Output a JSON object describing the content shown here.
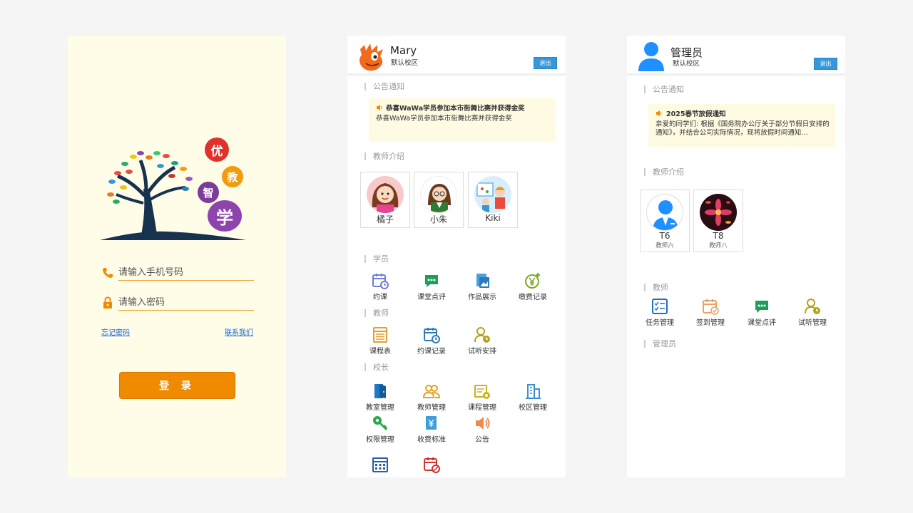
{
  "login": {
    "logo_chars": [
      "优",
      "教",
      "智",
      "学"
    ],
    "phone_placeholder": "请输入手机号码",
    "password_placeholder": "请输入密码",
    "forgot_password": "忘记密码",
    "contact_us": "联系我们",
    "login_button": "登 录"
  },
  "student": {
    "user_name": "Mary",
    "campus": "默认校区",
    "logout": "退出",
    "notice_section": "公告通知",
    "notice_title": "恭喜WaWa学员参加本市街舞比赛并获得金奖",
    "notice_body": "恭喜WaWa学员参加本市街舞比赛并获得金奖",
    "teacher_section": "教师介绍",
    "teachers": [
      {
        "name": "橘子"
      },
      {
        "name": "小朱"
      },
      {
        "name": "Kiki"
      }
    ],
    "section_student": "学员",
    "student_funcs": [
      "约课",
      "课堂点评",
      "作品展示",
      "缴费记录"
    ],
    "section_teacher": "教师",
    "teacher_funcs": [
      "课程表",
      "约课记录",
      "试听安排"
    ],
    "section_principal": "校长",
    "principal_funcs": [
      "教室管理",
      "教师管理",
      "课程管理",
      "校区管理",
      "权限管理",
      "收费标准",
      "公告"
    ]
  },
  "admin": {
    "user_name": "管理员",
    "campus": "默认校区",
    "logout": "退出",
    "notice_section": "公告通知",
    "notice_title": "2025春节放假通知",
    "notice_body": "亲爱的同学们: 根据《国务院办公厅关于部分节假日安排的通知》，并结合公司实际情况，现将放假时间通知…",
    "teacher_section": "教师介绍",
    "teachers": [
      {
        "name": "T6",
        "role": "教师六"
      },
      {
        "name": "T8",
        "role": "教师八"
      }
    ],
    "section_teacher": "教师",
    "teacher_funcs": [
      "任务管理",
      "签到管理",
      "课堂点评",
      "试听管理"
    ],
    "section_admin": "管理员"
  },
  "colors": {
    "accent_orange": "#f08a00",
    "button_blue": "#3498db",
    "notice_bg": "#fffbe3",
    "login_bg": "#fffde8"
  }
}
